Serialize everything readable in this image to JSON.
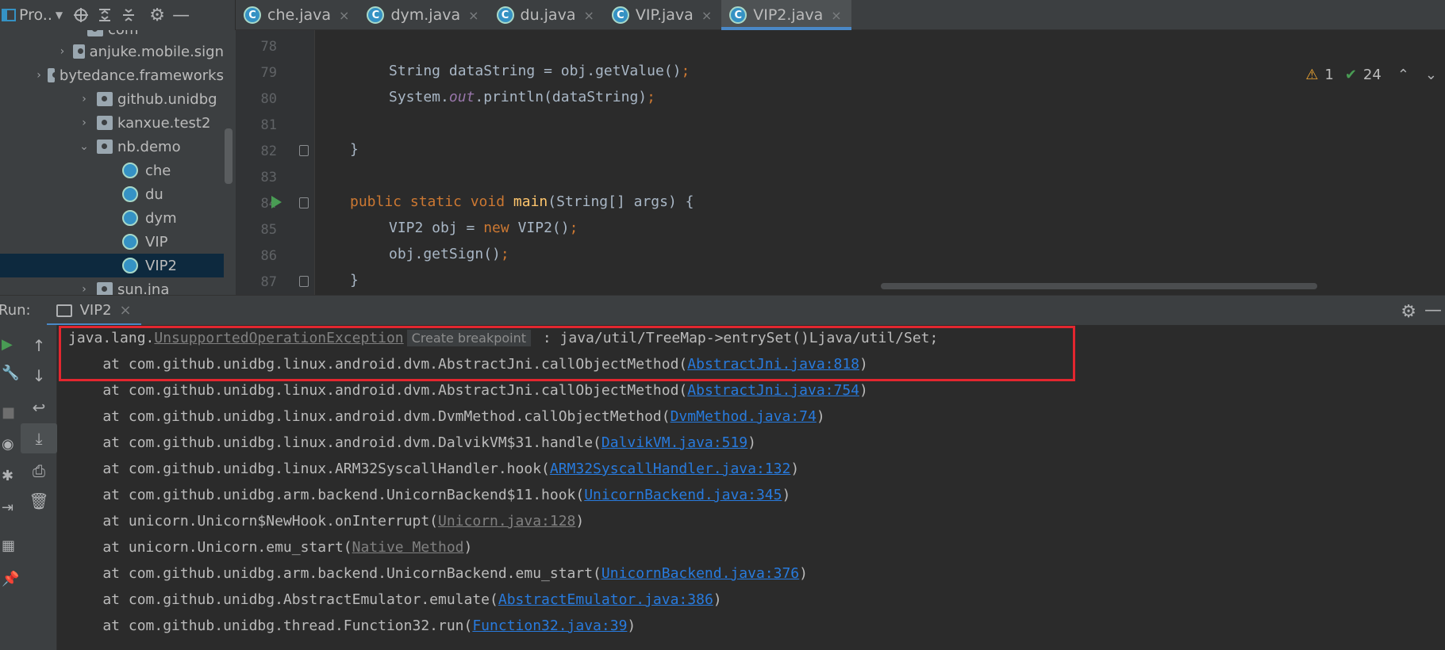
{
  "project_bar": {
    "label": "Pro..",
    "icons": [
      "project-icon",
      "target-icon",
      "expand-all-icon",
      "collapse-all-icon",
      "gear-icon",
      "minimize-icon"
    ]
  },
  "tabs": [
    {
      "label": "che.java",
      "active": false
    },
    {
      "label": "dym.java",
      "active": false
    },
    {
      "label": "du.java",
      "active": false
    },
    {
      "label": "VIP.java",
      "active": false
    },
    {
      "label": "VIP2.java",
      "active": true
    }
  ],
  "tab_close_glyph": "×",
  "tree": {
    "items": [
      {
        "label": "com",
        "kind": "package",
        "expanded": true
      },
      {
        "label": "anjuke.mobile.sign",
        "kind": "package",
        "expanded": false
      },
      {
        "label": "bytedance.frameworks",
        "kind": "package",
        "expanded": false
      },
      {
        "label": "github.unidbg",
        "kind": "package",
        "expanded": false
      },
      {
        "label": "kanxue.test2",
        "kind": "package",
        "expanded": false
      },
      {
        "label": "nb.demo",
        "kind": "package",
        "expanded": true
      },
      {
        "label": "che",
        "kind": "class"
      },
      {
        "label": "du",
        "kind": "class"
      },
      {
        "label": "dym",
        "kind": "class"
      },
      {
        "label": "VIP",
        "kind": "class"
      },
      {
        "label": "VIP2",
        "kind": "class",
        "selected": true
      },
      {
        "label": "sun.jna",
        "kind": "package",
        "expanded": false
      }
    ]
  },
  "editor": {
    "line_numbers": [
      "78",
      "79",
      "80",
      "81",
      "82",
      "83",
      "84",
      "85",
      "86",
      "87"
    ],
    "inspection": {
      "warnings": "1",
      "ok": "24"
    }
  },
  "run": {
    "label": "Run:",
    "tab_label": "VIP2",
    "close_glyph": "×"
  },
  "console": {
    "exception_prefix": "java.lang.",
    "exception_name": "UnsupportedOperationException",
    "breakpoint_hint": "Create breakpoint",
    "exception_message": " : java/util/TreeMap->entrySet()Ljava/util/Set;",
    "frames": [
      {
        "text": "    at com.github.unidbg.linux.android.dvm.AbstractJni.callObjectMethod(",
        "link": "AbstractJni.java:818",
        "grey": false
      },
      {
        "text": "    at com.github.unidbg.linux.android.dvm.AbstractJni.callObjectMethod(",
        "link": "AbstractJni.java:754",
        "grey": false
      },
      {
        "text": "    at com.github.unidbg.linux.android.dvm.DvmMethod.callObjectMethod(",
        "link": "DvmMethod.java:74",
        "grey": false
      },
      {
        "text": "    at com.github.unidbg.linux.android.dvm.DalvikVM$31.handle(",
        "link": "DalvikVM.java:519",
        "grey": false
      },
      {
        "text": "    at com.github.unidbg.linux.ARM32SyscallHandler.hook(",
        "link": "ARM32SyscallHandler.java:132",
        "grey": false
      },
      {
        "text": "    at com.github.unidbg.arm.backend.UnicornBackend$11.hook(",
        "link": "UnicornBackend.java:345",
        "grey": false
      },
      {
        "text": "    at unicorn.Unicorn$NewHook.onInterrupt(",
        "link": "Unicorn.java:128",
        "grey": true
      },
      {
        "text": "    at unicorn.Unicorn.emu_start(",
        "link": "Native Method",
        "grey": true
      },
      {
        "text": "    at com.github.unidbg.arm.backend.UnicornBackend.emu_start(",
        "link": "UnicornBackend.java:376",
        "grey": false
      },
      {
        "text": "    at com.github.unidbg.AbstractEmulator.emulate(",
        "link": "AbstractEmulator.java:386",
        "grey": false
      },
      {
        "text": "    at com.github.unidbg.thread.Function32.run(",
        "link": "Function32.java:39",
        "grey": false
      }
    ],
    "close_paren": ")"
  },
  "colors": {
    "highlight_box": "#e3262f",
    "link": "#287bde",
    "keyword": "#cc7832",
    "function": "#ffc66d"
  }
}
